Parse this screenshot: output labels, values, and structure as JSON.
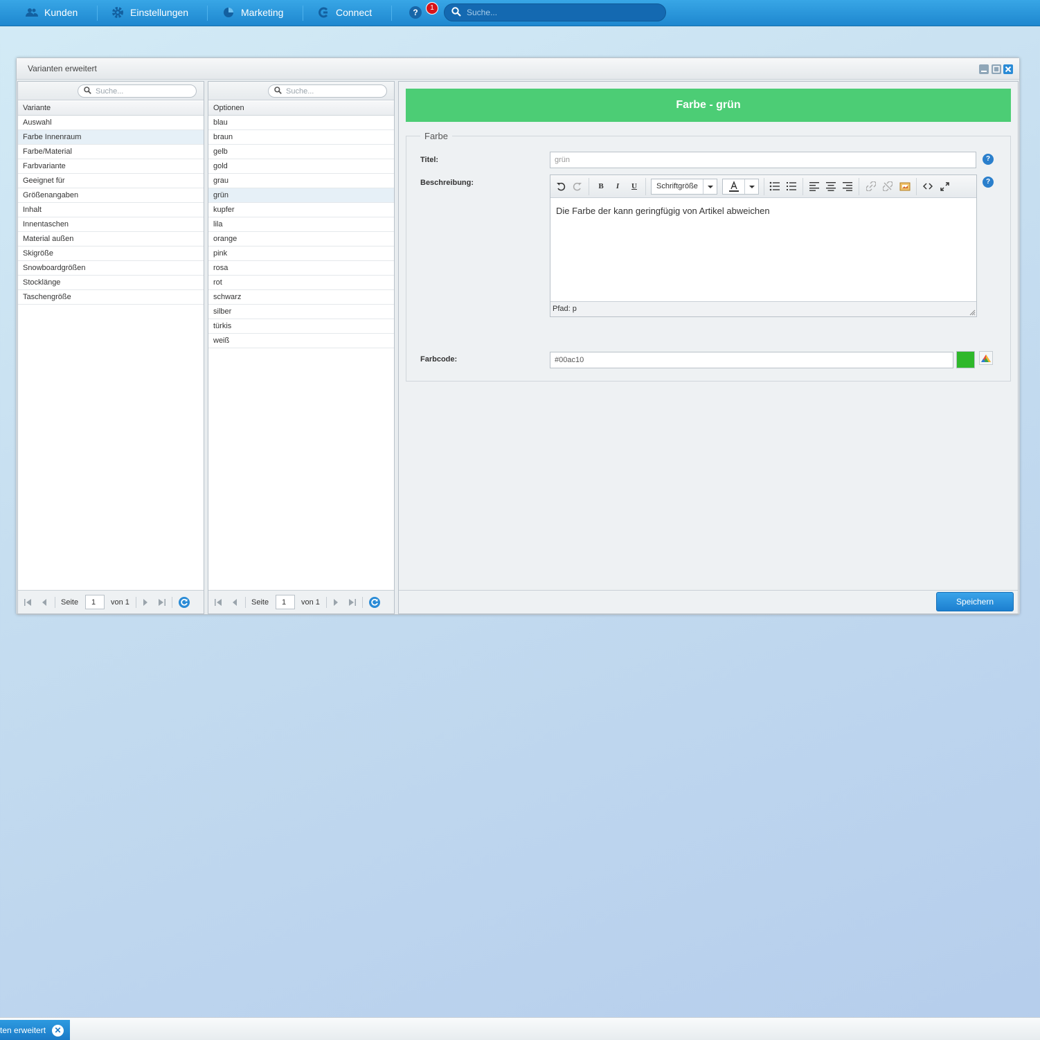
{
  "topnav": {
    "items": [
      {
        "label": "Kunden",
        "icon": "customers-icon"
      },
      {
        "label": "Einstellungen",
        "icon": "gear-icon"
      },
      {
        "label": "Marketing",
        "icon": "pie-chart-icon"
      },
      {
        "label": "Connect",
        "icon": "connect-icon"
      }
    ],
    "help_label": "?",
    "notification_count": "1",
    "search_placeholder": "Suche..."
  },
  "window": {
    "title": "Varianten erweitert"
  },
  "variants_panel": {
    "search_placeholder": "Suche...",
    "column_header": "Variante",
    "rows": [
      "Auswahl",
      "Farbe Innenraum",
      "Farbe/Material",
      "Farbvariante",
      "Geeignet für",
      "Größenangaben",
      "Inhalt",
      "Innentaschen",
      "Material außen",
      "Skigröße",
      "Snowboardgrößen",
      "Stocklänge",
      "Taschengröße"
    ],
    "selected_index": 1,
    "pager": {
      "page_label": "Seite",
      "page_value": "1",
      "of_label": "von 1"
    }
  },
  "options_panel": {
    "search_placeholder": "Suche...",
    "column_header": "Optionen",
    "rows": [
      "blau",
      "braun",
      "gelb",
      "gold",
      "grau",
      "grün",
      "kupfer",
      "lila",
      "orange",
      "pink",
      "rosa",
      "rot",
      "schwarz",
      "silber",
      "türkis",
      "weiß"
    ],
    "selected_index": 5,
    "pager": {
      "page_label": "Seite",
      "page_value": "1",
      "of_label": "von 1"
    }
  },
  "detail": {
    "banner": "Farbe - grün",
    "banner_color": "#4ccd75",
    "legend": "Farbe",
    "title_label": "Titel:",
    "title_value": "grün",
    "description_label": "Beschreibung:",
    "toolbar": {
      "fontsize_label": "Schriftgröße",
      "bold": "B",
      "italic": "I",
      "underline": "U"
    },
    "description_text": "Die Farbe der kann geringfügig von Artikel abweichen",
    "path_label": "Pfad: p",
    "colorcode_label": "Farbcode:",
    "colorcode_value": "#00ac10",
    "swatch_color": "#2fb82b",
    "help_label": "?",
    "save_label": "Speichern"
  },
  "taskbar": {
    "item_label": "ten erweitert",
    "close_label": "✕"
  }
}
